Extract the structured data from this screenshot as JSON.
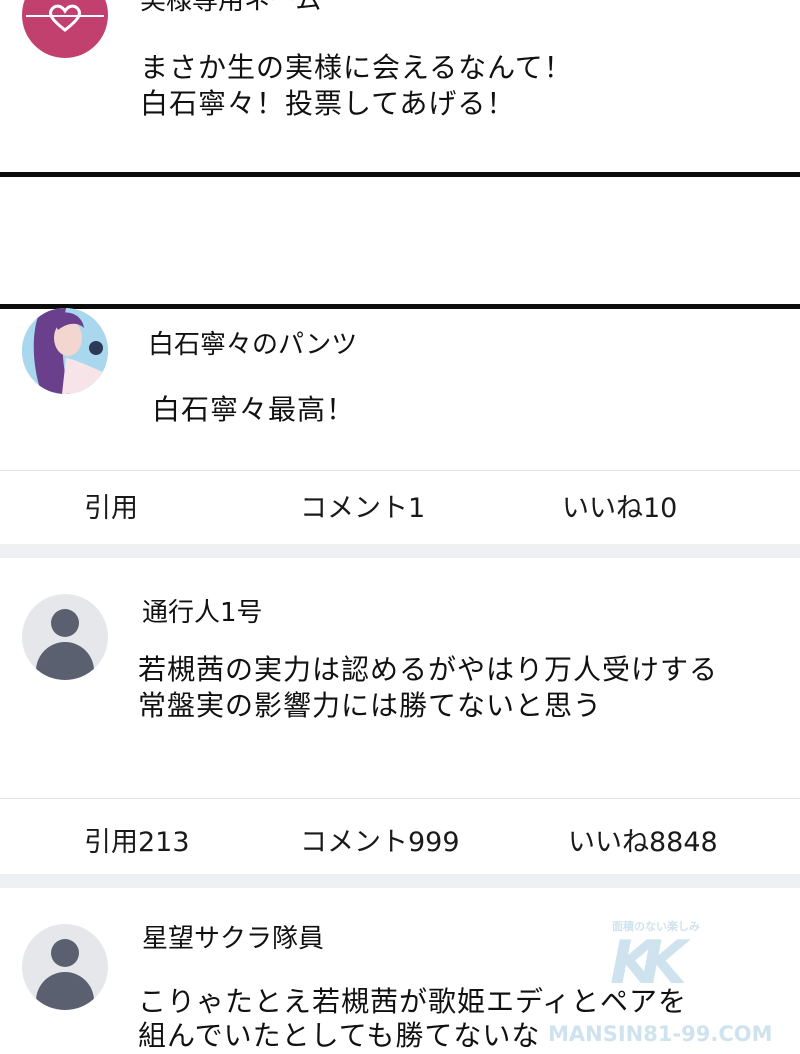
{
  "post0": {
    "name_partial": "実様専用ネーム",
    "body_lines": [
      "まさか生の実様に会えるなんて！",
      "白石寧々！投票してあげる！"
    ]
  },
  "post1": {
    "name": "白石寧々のパンツ",
    "body_lines": [
      "白石寧々最高！"
    ],
    "actions": {
      "quote": "引用",
      "comment": "コメント1",
      "like": "いいね10"
    }
  },
  "post2": {
    "name": "通行人1号",
    "body_lines": [
      "若槻茜の実力は認めるがやはり万人受けする",
      "常盤実の影響力には勝てないと思う"
    ],
    "actions": {
      "quote": "引用213",
      "comment": "コメント999",
      "like": "いいね8848"
    }
  },
  "post3": {
    "name": "星望サクラ隊員",
    "body_lines": [
      "こりゃたとえ若槻茜が歌姫エディとペアを",
      "組んでいたとしても勝てないな"
    ]
  },
  "watermark": {
    "tagline": "面積のない楽しみ",
    "logo": "KK",
    "site": "MANSIN81-99.COM"
  },
  "colors": {
    "accent_avatar": "#c2406e",
    "separator": "#0c0c0c",
    "gap": "#eef0f3",
    "avatar_gray": "#5b6070"
  }
}
